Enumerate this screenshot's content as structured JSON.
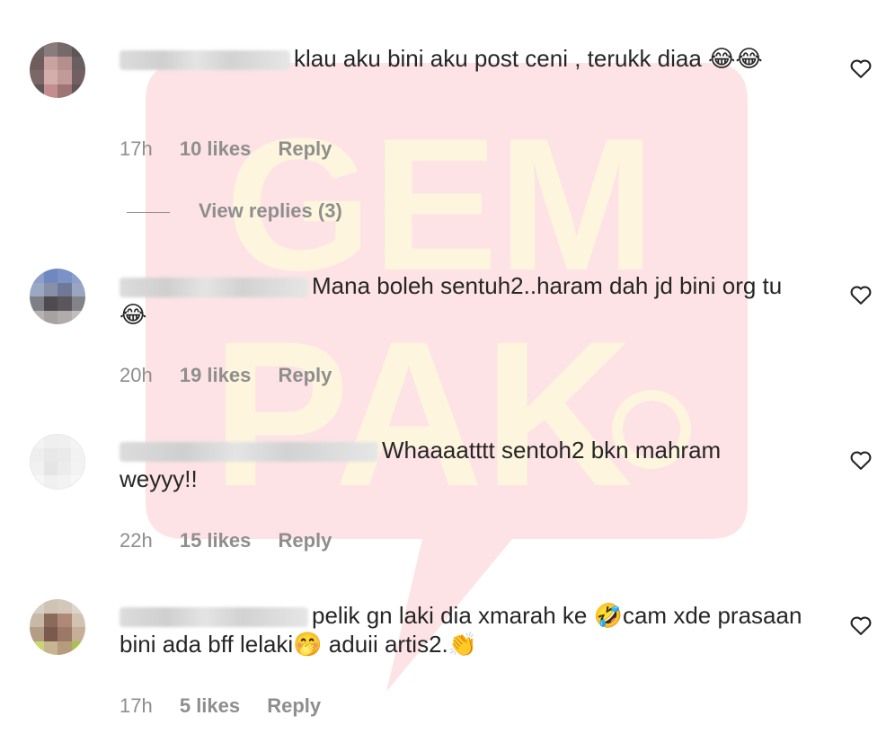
{
  "watermark": {
    "line1": "GEM",
    "line2": "PAK",
    "color_bg": "#fde2e4",
    "color_text": "#fdf4da"
  },
  "comments": [
    {
      "text": "klau aku bini aku post ceni , terukk diaa 😂😂",
      "time": "17h",
      "likes": "10 likes",
      "reply": "Reply",
      "view_replies": "View replies (3)"
    },
    {
      "text": "Mana boleh sentuh2..haram dah jd bini org tu😂",
      "time": "20h",
      "likes": "19 likes",
      "reply": "Reply"
    },
    {
      "text": "Whaaaatttt sentoh2 bkn mahram weyyy!!",
      "time": "22h",
      "likes": "15 likes",
      "reply": "Reply"
    },
    {
      "text": "pelik gn laki dia xmarah ke 🤣cam xde prasaan bini ada bff lelaki🤭 aduii artis2.👏",
      "time": "17h",
      "likes": "5 likes",
      "reply": "Reply"
    }
  ]
}
